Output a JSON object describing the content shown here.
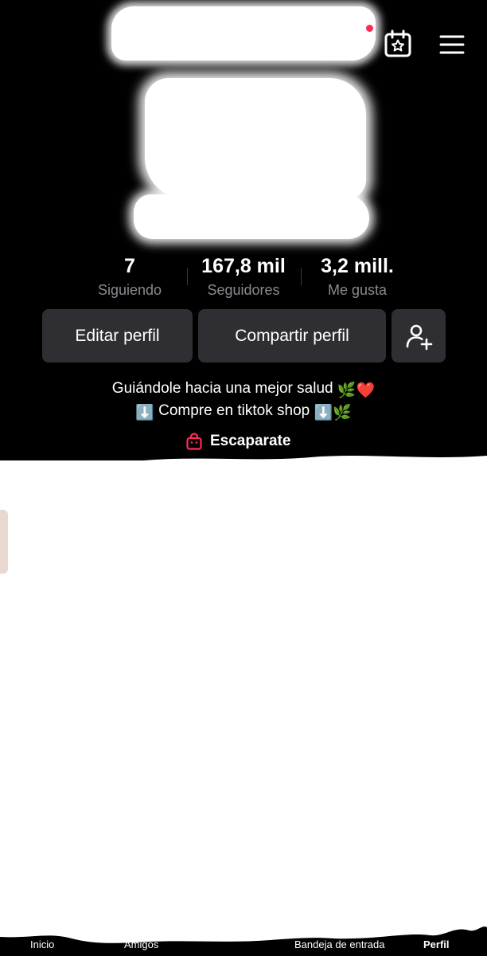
{
  "header": {
    "calendar_icon": "calendar-star-icon",
    "menu_icon": "hamburger-menu-icon",
    "notification_color": "#fe2c55"
  },
  "stats": {
    "following": {
      "value": "7",
      "label": "Siguiendo"
    },
    "followers": {
      "value": "167,8 mil",
      "label": "Seguidores"
    },
    "likes": {
      "value": "3,2 mill.",
      "label": "Me gusta"
    }
  },
  "actions": {
    "edit_label": "Editar perfil",
    "share_label": "Compartir perfil",
    "add_friend_icon": "add-user-icon"
  },
  "bio": {
    "line1_text": "Guiándole hacia una mejor salud",
    "line1_emoji": "🌿❤️",
    "line2_lead_emoji": "⬇️",
    "line2_text": "Compre en tiktok  shop",
    "line2_trail_emoji": "⬇️🌿"
  },
  "storefront": {
    "label": "Escaparate",
    "icon": "shopping-bag-icon",
    "accent_color": "#fe2c55"
  },
  "bottom_nav": {
    "home": "Inicio",
    "friends": "Amigos",
    "inbox": "Bandeja de entrada",
    "profile": "Perfil"
  },
  "colors": {
    "background": "#000000",
    "button": "#2f2f33",
    "muted_text": "#8a8b91",
    "accent": "#fe2c55"
  }
}
